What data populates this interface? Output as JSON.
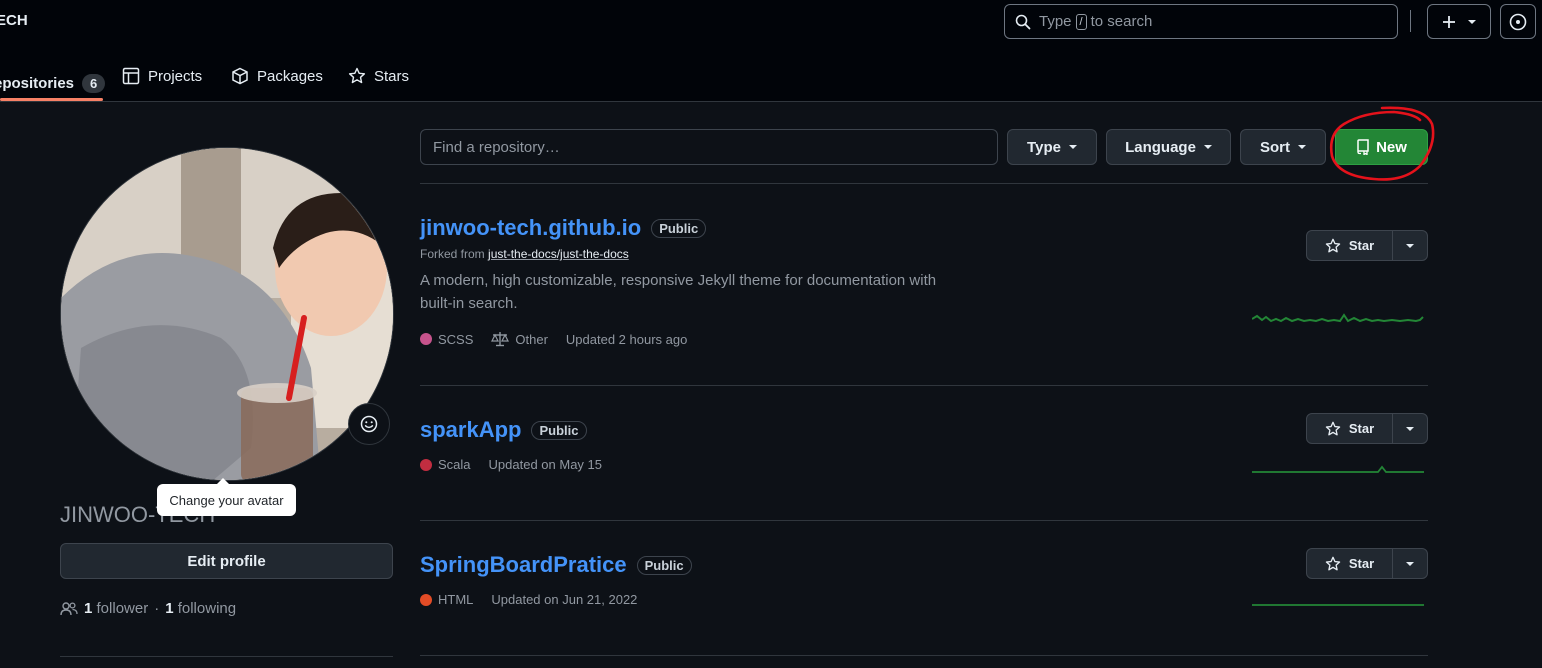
{
  "header": {
    "brand": "ECH",
    "search_prefix": "Type",
    "search_key": "/",
    "search_suffix": "to search"
  },
  "tabs": [
    {
      "label": "epositories",
      "count": "6",
      "icon": "repo-icon"
    },
    {
      "label": "Projects",
      "icon": "table-icon"
    },
    {
      "label": "Packages",
      "icon": "package-icon"
    },
    {
      "label": "Stars",
      "icon": "star-icon"
    }
  ],
  "profile": {
    "avatar_tooltip": "Change your avatar",
    "username": "JINWOO-TECH",
    "edit_button": "Edit profile",
    "followers_count": "1",
    "followers_label": "follower",
    "separator": "·",
    "following_count": "1",
    "following_label": "following"
  },
  "filters": {
    "find_placeholder": "Find a repository…",
    "type_label": "Type",
    "language_label": "Language",
    "sort_label": "Sort",
    "new_label": "New"
  },
  "repos": [
    {
      "name": "jinwoo-tech.github.io",
      "visibility": "Public",
      "forked_prefix": "Forked from",
      "forked_from": "just-the-docs/just-the-docs",
      "description": "A modern, high customizable, responsive Jekyll theme for documentation with built-in search.",
      "language": "SCSS",
      "language_color": "#c6538c",
      "license": "Other",
      "updated": "Updated 2 hours ago",
      "star_label": "Star"
    },
    {
      "name": "sparkApp",
      "visibility": "Public",
      "language": "Scala",
      "language_color": "#c22d40",
      "updated": "Updated on May 15",
      "star_label": "Star"
    },
    {
      "name": "SpringBoardPratice",
      "visibility": "Public",
      "language": "HTML",
      "language_color": "#e34c26",
      "updated": "Updated on Jun 21, 2022",
      "star_label": "Star"
    }
  ],
  "colors": {
    "accent_link": "#4493f8",
    "new_button": "#238636",
    "annotation_red": "#e5121b",
    "tab_underline": "#f78166"
  }
}
